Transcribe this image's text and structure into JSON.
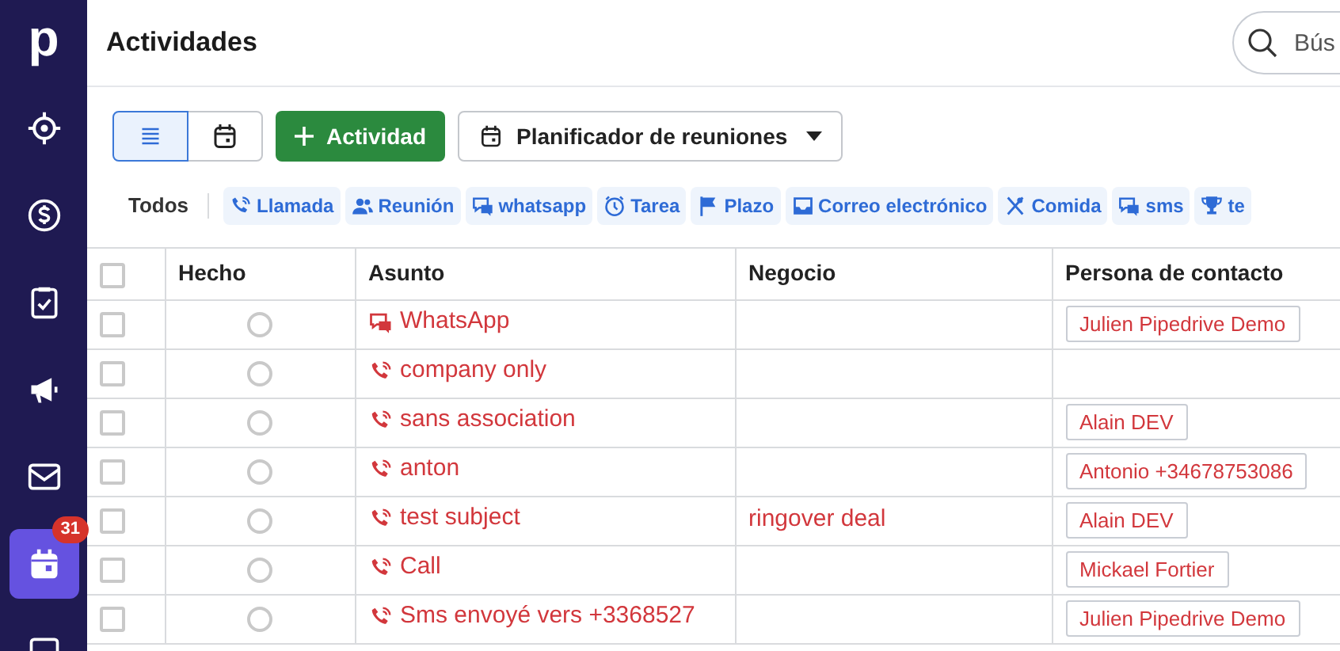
{
  "sidebar": {
    "logo": "p",
    "items": [
      {
        "selected": false
      },
      {
        "selected": false
      },
      {
        "selected": false
      },
      {
        "selected": false
      },
      {
        "selected": false
      },
      {
        "selected": true,
        "badge": "31"
      },
      {
        "selected": false
      }
    ]
  },
  "header": {
    "title": "Actividades",
    "search": {
      "placeholder": "Bús"
    }
  },
  "toolbar": {
    "views": [
      {
        "selected": true
      },
      {
        "selected": false
      }
    ],
    "add_button": "Actividad",
    "scheduler": "Planificador de reuniones"
  },
  "filters": {
    "all": "Todos",
    "types": [
      "Llamada",
      "Reunión",
      "whatsapp",
      "Tarea",
      "Plazo",
      "Correo electrónico",
      "Comida",
      "sms",
      "te"
    ]
  },
  "table": {
    "select_all_checked": false,
    "columns": [
      "Hecho",
      "Asunto",
      "Negocio",
      "Persona de contacto"
    ],
    "rows": [
      {
        "checked": false,
        "done": false,
        "kind": "chat",
        "subject": "WhatsApp",
        "deal": "",
        "contact": "Julien Pipedrive Demo"
      },
      {
        "checked": false,
        "done": false,
        "kind": "phone",
        "subject": "company only",
        "deal": "",
        "contact": ""
      },
      {
        "checked": false,
        "done": false,
        "kind": "phone",
        "subject": "sans association",
        "deal": "",
        "contact": "Alain DEV"
      },
      {
        "checked": false,
        "done": false,
        "kind": "phone",
        "subject": "anton",
        "deal": "",
        "contact": "Antonio +34678753086"
      },
      {
        "checked": false,
        "done": false,
        "kind": "phone",
        "subject": "test subject",
        "deal": "ringover deal",
        "contact": "Alain DEV"
      },
      {
        "checked": false,
        "done": false,
        "kind": "phone",
        "subject": "Call",
        "deal": "",
        "contact": "Mickael Fortier"
      },
      {
        "checked": false,
        "done": false,
        "kind": "phone",
        "subject": "Sms envoyé vers +3368527",
        "deal": "",
        "contact": "Julien Pipedrive Demo"
      }
    ]
  }
}
